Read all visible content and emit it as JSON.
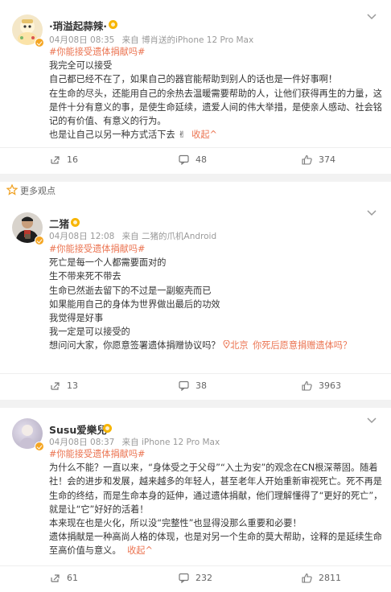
{
  "posts": [
    {
      "username": "·琑溢起蒜辣·",
      "time": "04月08日 08:35",
      "source": "来自 博肖送的iPhone 12 Pro Max",
      "topic": "#你能接受遗体捐献吗#",
      "lines": [
        "我完全可以接受",
        "自己都已经不在了，如果自己的器官能帮助到别人的话也是一件好事啊！",
        "在生命的尽头，还能用自己的余热去温暖需要帮助的人，让他们获得再生的力量，这是件十分有意义的事，是使生命延续，遗爱人间的伟大举措，是使亲人感动、社会铭记的有价值、有意义的行为。",
        "也是让自己以另一种方式活下去"
      ],
      "collapse": "收起^",
      "shares": "16",
      "comments": "48",
      "likes": "374"
    },
    {
      "username": "二猪",
      "time": "04月08日 12:08",
      "source": "来自 二猪的爪机Android",
      "topic": "#你能接受遗体捐献吗#",
      "lines": [
        "死亡是每一个人都需要面对的",
        "生不带来死不带去",
        "生命已然逝去留下的不过是一副躯壳而已",
        "如果能用自己的身体为世界做出最后的功效",
        "我觉得是好事",
        "我一定是可以接受的",
        "想问问大家，你愿意签署遗体捐赠协议吗？"
      ],
      "location": "北京",
      "linked": "你死后愿意捐赠遗体吗？",
      "shares": "13",
      "comments": "38",
      "likes": "3963"
    },
    {
      "username": "Susu爱樂兒",
      "time": "04月08日 08:37",
      "source": "来自 iPhone 12 Pro Max",
      "topic": "#你能接受遗体捐献吗#",
      "lines": [
        "为什么不能？一直以来，“身体受之于父母”“入土为安”的观念在CN根深蒂固。随着社！会的进步和发展，越来越多的年轻人，甚至老年人开始重新审视死亡。死不再是生命的终结，而是生命本身的延伸，通过遗体捐献，他们理解懂得了“更好的死亡”，就是让“它”好好的活着！",
        "本来现在也是火化，所以没“完整性”也显得没那么重要和必要！",
        "遗体捐献是一种高尚人格的体现，也是对另一个生命的莫大帮助，诠释的是延续生命至高价值与意义。"
      ],
      "collapse": "收起^",
      "shares": "61",
      "comments": "232",
      "likes": "2811"
    }
  ],
  "section_label": "更多观点"
}
